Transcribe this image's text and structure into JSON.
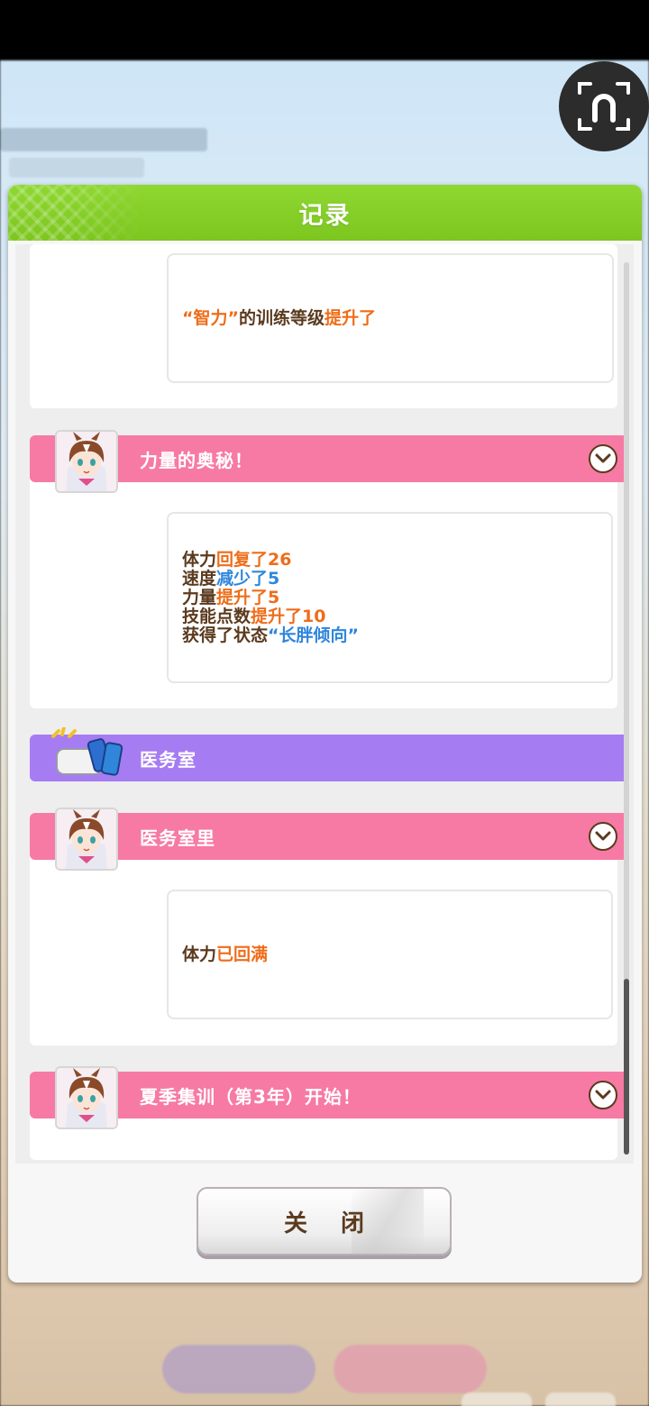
{
  "dialog": {
    "title": "记录",
    "close_label": "关 闭"
  },
  "log": {
    "top_entry": {
      "segments": [
        {
          "text": "“智力”",
          "color": "orange"
        },
        {
          "text": "的训练等级",
          "color": "brown"
        },
        {
          "text": "提升了",
          "color": "orange"
        }
      ]
    },
    "events": [
      {
        "title": "力量的奥秘！",
        "type": "character",
        "lines": [
          [
            {
              "text": "体力",
              "color": "brown"
            },
            {
              "text": "回复了26",
              "color": "orange"
            }
          ],
          [
            {
              "text": "速度",
              "color": "brown"
            },
            {
              "text": "减少了5",
              "color": "blue"
            }
          ],
          [
            {
              "text": "力量",
              "color": "brown"
            },
            {
              "text": "提升了5",
              "color": "orange"
            }
          ],
          [
            {
              "text": "技能点数",
              "color": "brown"
            },
            {
              "text": "提升了10",
              "color": "orange"
            }
          ],
          [
            {
              "text": "获得了状态",
              "color": "brown"
            },
            {
              "text": "“长胖倾向”",
              "color": "blue"
            }
          ]
        ]
      },
      {
        "title": "医务室",
        "type": "category"
      },
      {
        "title": "医务室里",
        "type": "character",
        "lines": [
          [
            {
              "text": "体力",
              "color": "brown"
            },
            {
              "text": "已回满",
              "color": "orange"
            }
          ]
        ]
      },
      {
        "title": "夏季集训（第3年）开始！",
        "type": "character"
      }
    ]
  },
  "colors": {
    "header_green": "#7cc61f",
    "event_pink": "#f67aa4",
    "category_purple": "#a67cf2",
    "text_brown": "#5b3a1e",
    "text_orange": "#ee6d1a",
    "text_blue": "#2f86db"
  },
  "icons": {
    "capture": "camera-capture-icon",
    "expand": "chevron-down-icon",
    "infirmary": "infirmary-pillow-drink-icon",
    "character": "character-portrait"
  }
}
